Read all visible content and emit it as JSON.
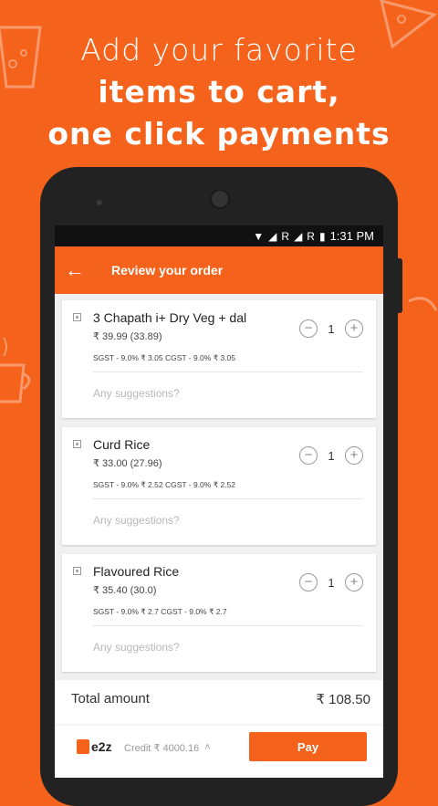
{
  "headline": {
    "line1": "Add your favorite",
    "line2": "items to cart,",
    "line3": "one click payments"
  },
  "status_bar": {
    "time": "1:31 PM",
    "icons": [
      "wifi-icon",
      "signal-icon",
      "signal-icon",
      "battery-icon"
    ]
  },
  "app_bar": {
    "title": "Review your order",
    "back_icon": "arrow-left-icon"
  },
  "items": [
    {
      "name": "3 Chapath i+ Dry Veg + dal",
      "price": "₹ 39.99 (33.89)",
      "tax": "SGST - 9.0% ₹ 3.05 CGST - 9.0% ₹ 3.05",
      "quantity": "1",
      "suggestion_placeholder": "Any suggestions?"
    },
    {
      "name": "Curd Rice",
      "price": "₹ 33.00 (27.96)",
      "tax": "SGST - 9.0% ₹ 2.52 CGST - 9.0% ₹ 2.52",
      "quantity": "1",
      "suggestion_placeholder": "Any suggestions?"
    },
    {
      "name": "Flavoured Rice",
      "price": "₹ 35.40 (30.0)",
      "tax": "SGST - 9.0% ₹ 2.7 CGST - 9.0% ₹ 2.7",
      "quantity": "1",
      "suggestion_placeholder": "Any suggestions?"
    }
  ],
  "footer": {
    "total_label": "Total amount",
    "total_value": "₹ 108.50",
    "brand": "e2z",
    "credit_text": "Credit ₹ 4000.16",
    "pay_label": "Pay"
  },
  "colors": {
    "accent": "#f4621b"
  }
}
